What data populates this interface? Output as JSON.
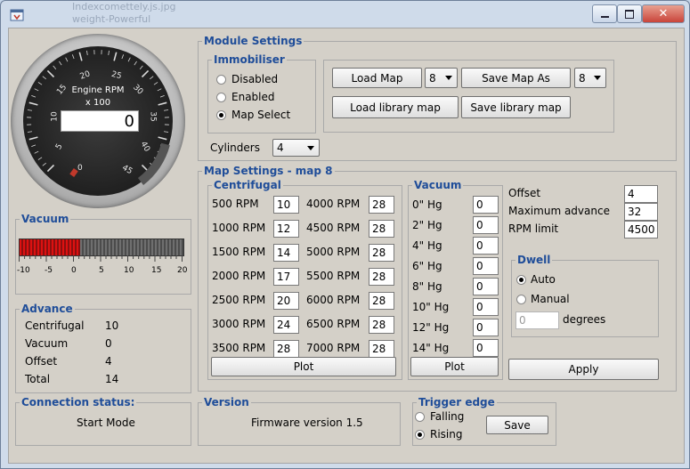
{
  "window": {
    "title_ghost_1": "Indexcomettely.js.jpg",
    "title_ghost_2": "weight-Powerful"
  },
  "gauge": {
    "title": "Engine RPM",
    "multiplier": "x 100",
    "value": "0",
    "ticks": [
      "0",
      "5",
      "10",
      "15",
      "20",
      "25",
      "30",
      "35",
      "40",
      "45"
    ]
  },
  "vacuum_bar": {
    "title": "Vacuum",
    "labels": [
      "-10",
      "-5",
      "0",
      "5",
      "10",
      "15",
      "20"
    ],
    "level_fraction": 0.37
  },
  "advance": {
    "title": "Advance",
    "rows": [
      {
        "label": "Centrifugal",
        "value": "10"
      },
      {
        "label": "Vacuum",
        "value": "0"
      },
      {
        "label": "Offset",
        "value": "4"
      },
      {
        "label": "Total",
        "value": "14"
      }
    ]
  },
  "connection": {
    "title": "Connection status:",
    "value": "Start Mode"
  },
  "version": {
    "title": "Version",
    "value": "Firmware version 1.5"
  },
  "module": {
    "title": "Module Settings",
    "immobiliser": {
      "title": "Immobiliser",
      "options": [
        "Disabled",
        "Enabled",
        "Map Select"
      ],
      "selected": "Map Select"
    },
    "load_map": "Load Map",
    "load_map_select": "8",
    "save_map_as": "Save Map As",
    "save_map_select": "8",
    "load_library": "Load library map",
    "save_library": "Save library map",
    "cylinders_label": "Cylinders",
    "cylinders_value": "4"
  },
  "map": {
    "title": "Map Settings - map 8",
    "centrifugal": {
      "title": "Centrifugal",
      "left": [
        {
          "rpm": "500 RPM",
          "v": "10"
        },
        {
          "rpm": "1000 RPM",
          "v": "12"
        },
        {
          "rpm": "1500 RPM",
          "v": "14"
        },
        {
          "rpm": "2000 RPM",
          "v": "17"
        },
        {
          "rpm": "2500 RPM",
          "v": "20"
        },
        {
          "rpm": "3000 RPM",
          "v": "24"
        },
        {
          "rpm": "3500 RPM",
          "v": "28"
        }
      ],
      "right": [
        {
          "rpm": "4000 RPM",
          "v": "28"
        },
        {
          "rpm": "4500 RPM",
          "v": "28"
        },
        {
          "rpm": "5000 RPM",
          "v": "28"
        },
        {
          "rpm": "5500 RPM",
          "v": "28"
        },
        {
          "rpm": "6000 RPM",
          "v": "28"
        },
        {
          "rpm": "6500 RPM",
          "v": "28"
        },
        {
          "rpm": "7000 RPM",
          "v": "28"
        }
      ],
      "plot": "Plot"
    },
    "vacuum": {
      "title": "Vacuum",
      "rows": [
        {
          "hg": "0\" Hg",
          "v": "0"
        },
        {
          "hg": "2\" Hg",
          "v": "0"
        },
        {
          "hg": "4\" Hg",
          "v": "0"
        },
        {
          "hg": "6\" Hg",
          "v": "0"
        },
        {
          "hg": "8\" Hg",
          "v": "0"
        },
        {
          "hg": "10\" Hg",
          "v": "0"
        },
        {
          "hg": "12\" Hg",
          "v": "0"
        },
        {
          "hg": "14\" Hg",
          "v": "0"
        }
      ],
      "plot": "Plot"
    },
    "offset_label": "Offset",
    "offset_value": "4",
    "max_adv_label": "Maximum advance",
    "max_adv_value": "32",
    "rpm_limit_label": "RPM limit",
    "rpm_limit_value": "4500",
    "dwell": {
      "title": "Dwell",
      "auto": "Auto",
      "manual": "Manual",
      "selected": "Auto",
      "degrees_value": "0",
      "degrees_label": "degrees"
    },
    "apply": "Apply"
  },
  "trigger": {
    "title": "Trigger edge",
    "falling": "Falling",
    "rising": "Rising",
    "selected": "Rising",
    "save": "Save"
  }
}
